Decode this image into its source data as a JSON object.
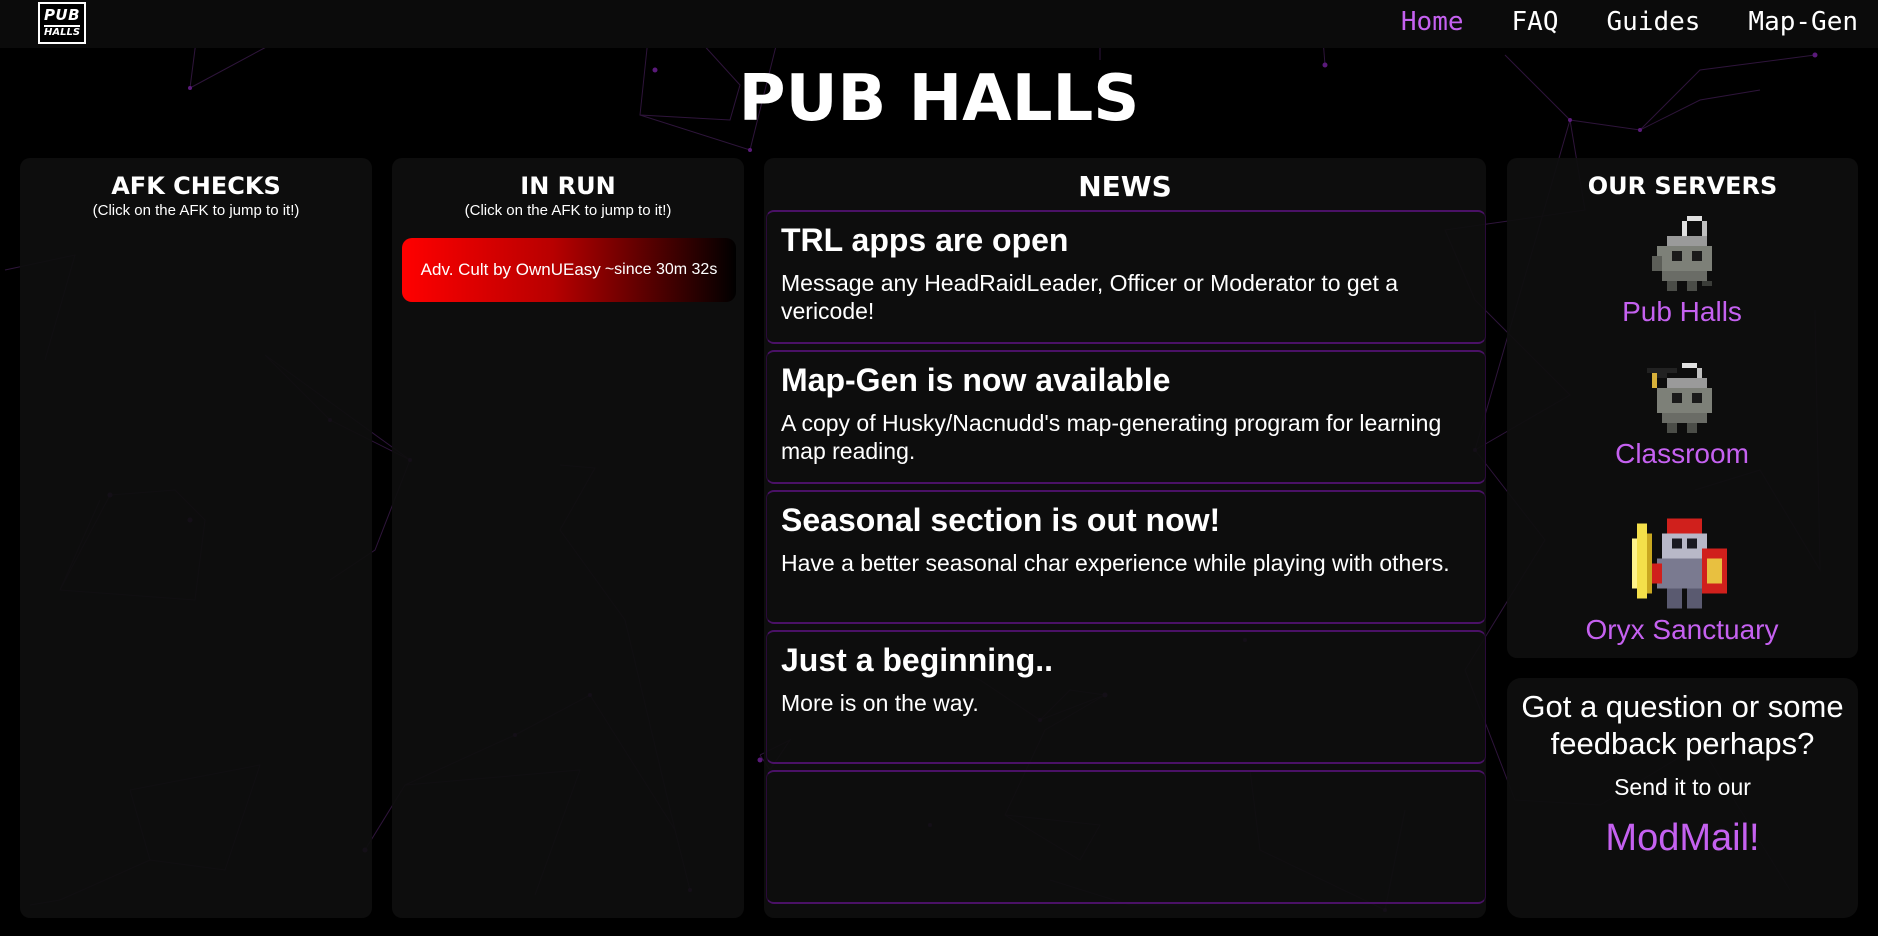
{
  "logo": {
    "line1": "PUB",
    "line2": "HALLS"
  },
  "nav": {
    "home": "Home",
    "faq": "FAQ",
    "guides": "Guides",
    "mapgen": "Map-Gen"
  },
  "title": "PUB HALLS",
  "afk": {
    "title": "AFK CHECKS",
    "subtitle": "(Click on the AFK to jump to it!)"
  },
  "inrun": {
    "title": "IN RUN",
    "subtitle": "(Click on the AFK to jump to it!)",
    "cards": [
      {
        "label": "Adv. Cult by OwnUEasy",
        "since": "~since 30m 32s"
      }
    ]
  },
  "news": {
    "title": "NEWS",
    "items": [
      {
        "heading": "TRL apps are open",
        "body": "Message any HeadRaidLeader, Officer or Moderator to get a vericode!"
      },
      {
        "heading": "Map-Gen is now available",
        "body": "A copy of Husky/Nacnudd's map-generating program for learning map reading."
      },
      {
        "heading": "Seasonal section is out now!",
        "body": "Have a better seasonal char experience while playing with others."
      },
      {
        "heading": "Just a beginning..",
        "body": "More is on the way."
      }
    ]
  },
  "servers": {
    "title": "OUR SERVERS",
    "list": [
      {
        "name": "Pub Halls",
        "icon": "ghost-sprite-icon"
      },
      {
        "name": "Classroom",
        "icon": "graduate-ghost-sprite-icon"
      },
      {
        "name": "Oryx Sanctuary",
        "icon": "oryx-knight-sprite-icon"
      }
    ]
  },
  "feedback": {
    "question": "Got a question or some feedback perhaps?",
    "send": "Send it to our",
    "link": "ModMail!"
  },
  "colors": {
    "accent": "#c561f0",
    "panel": "#0e0e0e",
    "news_border": "#4a1166",
    "card_red": "#ff0000"
  }
}
